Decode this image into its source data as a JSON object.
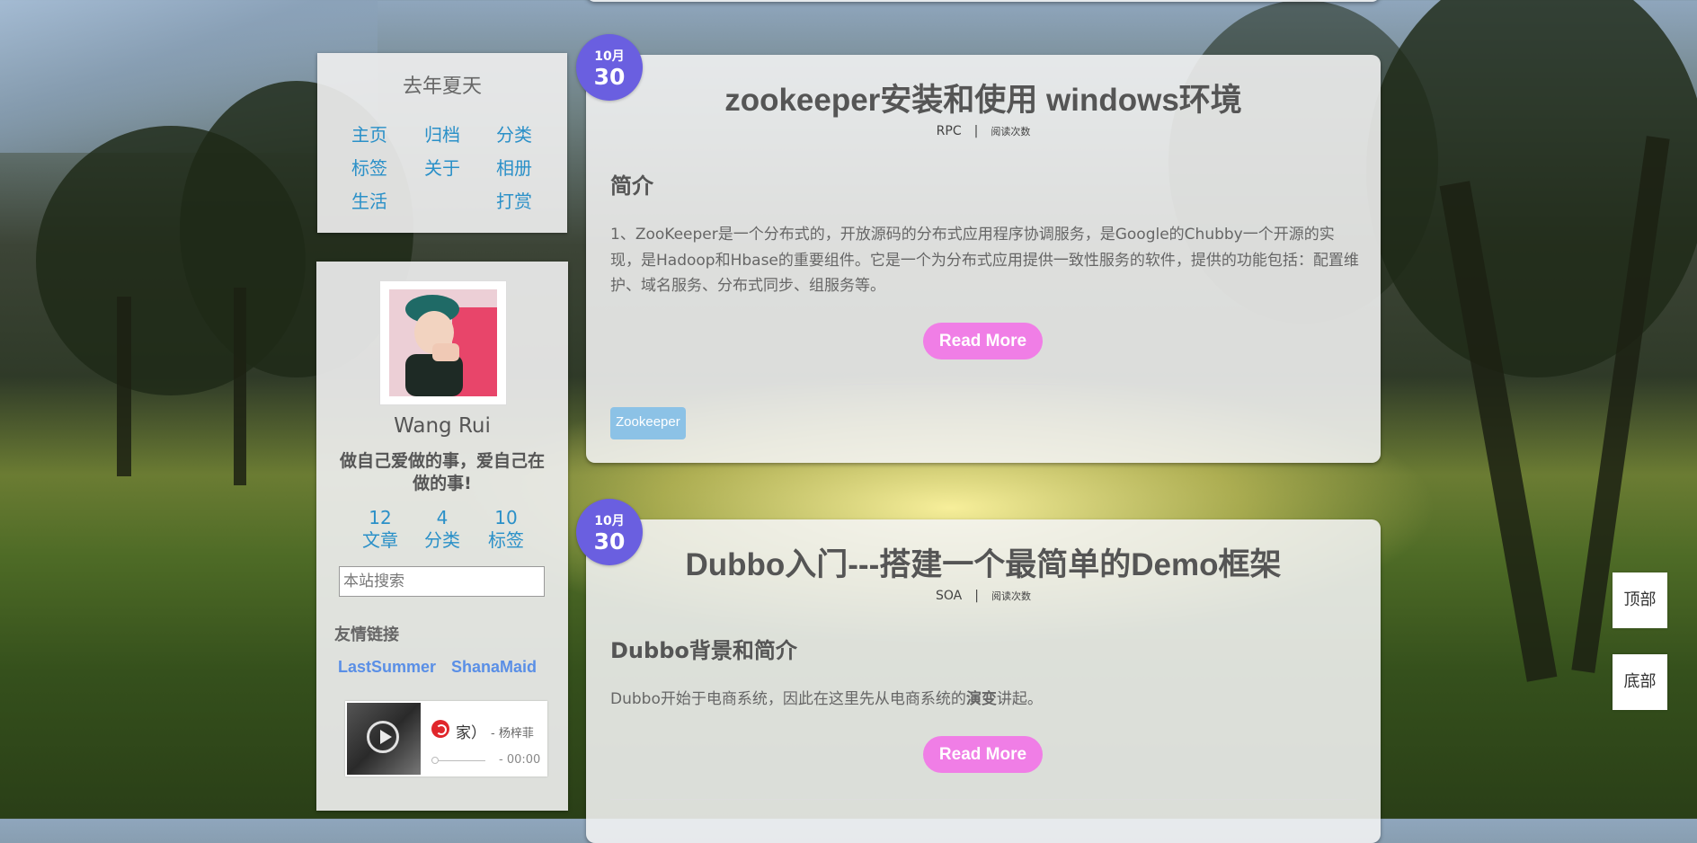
{
  "site": {
    "title": "去年夏天",
    "nav": [
      {
        "label": "主页"
      },
      {
        "label": "归档"
      },
      {
        "label": "分类"
      },
      {
        "label": "标签"
      },
      {
        "label": "关于"
      },
      {
        "label": "相册"
      },
      {
        "label": "生活"
      },
      {
        "label": "打赏"
      }
    ]
  },
  "author": {
    "name": "Wang Rui",
    "motto": "做自己爱做的事，爱自己在做的事!",
    "stats": [
      {
        "value": "12",
        "label": "文章"
      },
      {
        "value": "4",
        "label": "分类"
      },
      {
        "value": "10",
        "label": "标签"
      }
    ]
  },
  "search": {
    "placeholder": "本站搜索"
  },
  "links": {
    "title": "友情链接",
    "items": [
      {
        "label": "LastSummer"
      },
      {
        "label": "ShanaMaid"
      }
    ]
  },
  "player": {
    "song": "家）",
    "artist": "- 杨梓菲",
    "time": "- 00:00",
    "progress": 0
  },
  "posts": [
    {
      "date_month": "10月",
      "date_day": "30",
      "title": "zookeeper安装和使用 windows环境",
      "category": "RPC",
      "separator": "|",
      "reads_label": "阅读次数",
      "heading": "简介",
      "body": "1、ZooKeeper是一个分布式的，开放源码的分布式应用程序协调服务，是Google的Chubby一个开源的实现，是Hadoop和Hbase的重要组件。它是一个为分布式应用提供一致性服务的软件，提供的功能包括：配置维护、域名服务、分布式同步、组服务等。",
      "read_more": "Read More",
      "tag": "Zookeeper"
    },
    {
      "date_month": "10月",
      "date_day": "30",
      "title": "Dubbo入门---搭建一个最简单的Demo框架",
      "category": "SOA",
      "separator": "|",
      "reads_label": "阅读次数",
      "heading": "Dubbo背景和简介",
      "body_pre": "Dubbo开始于电商系统，因此在这里先从电商系统的",
      "body_bold": "演变",
      "body_post": "讲起。",
      "read_more": "Read More"
    }
  ],
  "float": {
    "top": "顶部",
    "bottom": "底部"
  },
  "colors": {
    "accent": "#2a90c8",
    "date_badge": "#6a5fe0",
    "read_more": "#f07ee6",
    "tag": "#8cc2e6",
    "friend_link": "#5a8fe6"
  }
}
